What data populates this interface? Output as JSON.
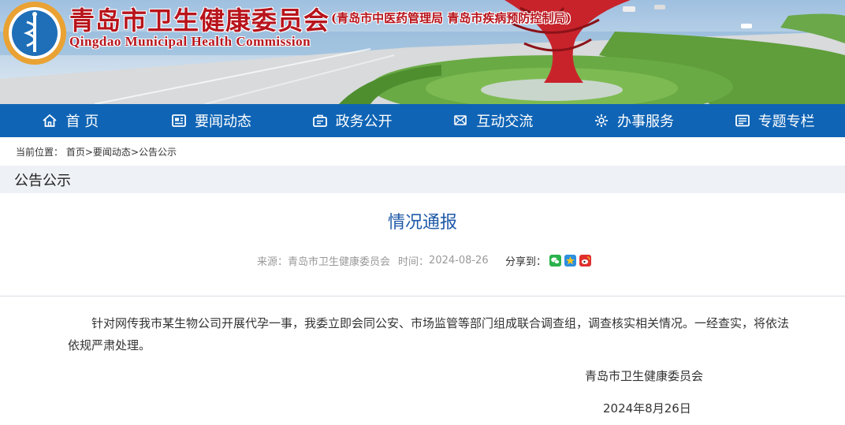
{
  "header": {
    "title": "青岛市卫生健康委员会",
    "subtitle": "(青岛市中医药管理局 青岛市疾病预防控制局)",
    "title_en": "Qingdao Municipal Health Commission"
  },
  "nav": {
    "items": [
      {
        "label": "首 页",
        "icon": "home-icon"
      },
      {
        "label": "要闻动态",
        "icon": "news-icon"
      },
      {
        "label": "政务公开",
        "icon": "briefcase-icon"
      },
      {
        "label": "互动交流",
        "icon": "exchange-icon"
      },
      {
        "label": "办事服务",
        "icon": "gear-icon"
      },
      {
        "label": "专题专栏",
        "icon": "column-icon"
      }
    ]
  },
  "breadcrumb": {
    "prefix": "当前位置：",
    "items": [
      "首页",
      "要闻动态",
      "公告公示"
    ],
    "separator": ">"
  },
  "section": {
    "title": "公告公示"
  },
  "article": {
    "title": "情况通报",
    "source_label": "来源：",
    "source": "青岛市卫生健康委员会",
    "time_label": "时间：",
    "time": "2024-08-26",
    "share_label": "分享到：",
    "share_icons": [
      "wechat-icon",
      "qzone-icon",
      "weibo-icon"
    ],
    "body": "针对网传我市某生物公司开展代孕一事，我委立即会同公安、市场监管等部门组成联合调查组，调查核实相关情况。一经查实，将依法依规严肃处理。",
    "sign_org": "青岛市卫生健康委员会",
    "sign_date": "2024年8月26日"
  },
  "colors": {
    "nav_bg": "#0f64b5",
    "title_red": "#b8141c",
    "article_title": "#1f5aa8",
    "section_bg": "#eef1f5"
  }
}
